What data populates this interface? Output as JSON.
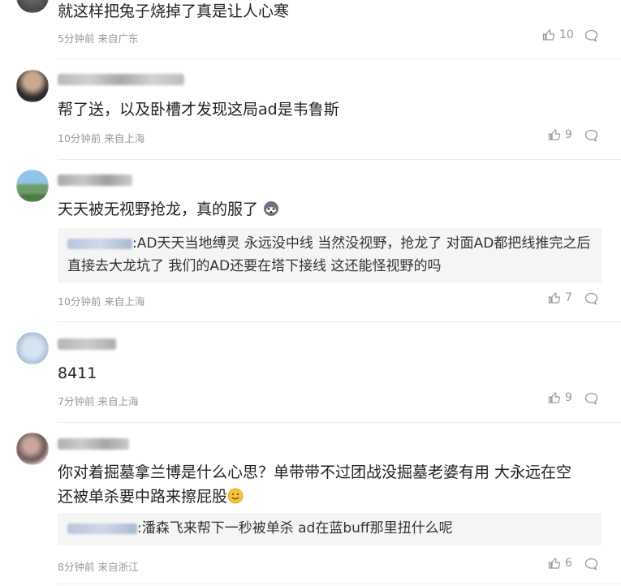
{
  "comments": [
    {
      "text": "就这样把兔子烧掉了真是让人心寒",
      "meta": {
        "time": "5分钟前",
        "location": "来自广东"
      },
      "likes": "10"
    },
    {
      "text": "帮了送，以及卧槽才发现这局ad是韦鲁斯",
      "meta": {
        "time": "10分钟前",
        "location": "来自上海"
      },
      "likes": "9"
    },
    {
      "text": "天天被无视野抢龙，真的服了",
      "reply": {
        "text": ":AD天天当地缚灵 永远没中线 当然没视野，抢龙了 对面AD都把线推完之后直接去大龙坑了 我们的AD还要在塔下接线 这还能怪视野的吗"
      },
      "meta": {
        "time": "10分钟前",
        "location": "来自上海"
      },
      "likes": "7"
    },
    {
      "text": "8411",
      "meta": {
        "time": "7分钟前",
        "location": "来自上海"
      },
      "likes": "9"
    },
    {
      "text_line1": "你对着掘墓拿兰博是什么心思？单带带不过团战没掘墓老婆有用 大永远在空",
      "text_line2": "还被单杀要中路来擦屁股",
      "reply": {
        "text": ":潘森飞来帮下一秒被单杀 ad在蓝buff那里扭什么呢"
      },
      "meta": {
        "time": "8分钟前",
        "location": "来自浙江"
      },
      "likes": "6"
    }
  ],
  "icons": {
    "like": "thumbs-up-icon",
    "reply": "comment-bubble-icon"
  },
  "colors": {
    "meta": "#999999",
    "reply_bg": "#f5f5f5"
  }
}
